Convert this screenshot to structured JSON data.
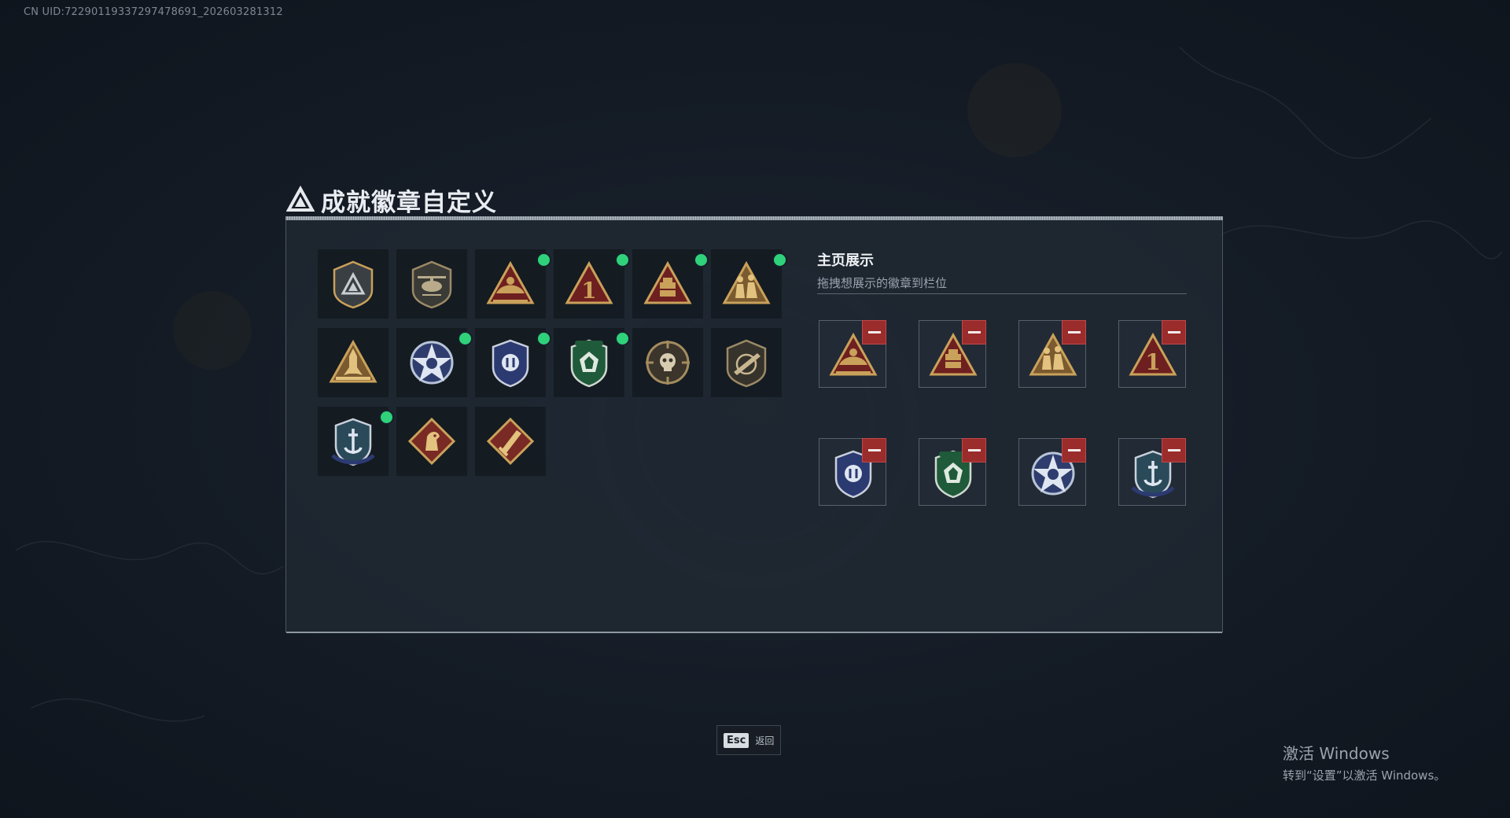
{
  "uid": "CN UID:72290119337297478691_202603281312",
  "title": "成就徽章自定义",
  "display": {
    "title": "主页展示",
    "subtitle": "拖拽想展示的徽章到栏位"
  },
  "badges": [
    {
      "icon": "triangle-shield-icon",
      "new": false
    },
    {
      "icon": "helicopter-shield-icon",
      "new": false
    },
    {
      "icon": "bag-triangle-icon",
      "new": true
    },
    {
      "icon": "number-one-triangle-icon",
      "new": true
    },
    {
      "icon": "crate-triangle-icon",
      "new": true
    },
    {
      "icon": "soldiers-triangle-icon",
      "new": true
    },
    {
      "icon": "rocket-triangle-icon",
      "new": false
    },
    {
      "icon": "star-emblem-icon",
      "new": true
    },
    {
      "icon": "blue-shield-emblem-icon",
      "new": true
    },
    {
      "icon": "green-shield-emblem-icon",
      "new": true
    },
    {
      "icon": "skull-crosshair-icon",
      "new": false
    },
    {
      "icon": "rifle-shield-icon",
      "new": false
    },
    {
      "icon": "anchor-shield-emblem-icon",
      "new": true
    },
    {
      "icon": "horse-diamond-icon",
      "new": false
    },
    {
      "icon": "knife-diamond-icon",
      "new": false
    }
  ],
  "display_slots": [
    {
      "icon": "bag-triangle-icon"
    },
    {
      "icon": "crate-triangle-icon"
    },
    {
      "icon": "soldiers-triangle-icon"
    },
    {
      "icon": "number-one-triangle-icon"
    },
    {
      "icon": "blue-shield-emblem-icon"
    },
    {
      "icon": "green-shield-emblem-icon"
    },
    {
      "icon": "star-emblem-icon"
    },
    {
      "icon": "anchor-shield-emblem-icon"
    }
  ],
  "esc": {
    "key": "Esc",
    "label": "返回"
  },
  "watermark": {
    "line1": "激活 Windows",
    "line2": "转到“设置”以激活 Windows。"
  },
  "colors": {
    "new_indicator": "#2fd27a",
    "remove_button": "#9a2c2c",
    "gold": "#c9a15a",
    "dark_red": "#6e1f1f"
  }
}
